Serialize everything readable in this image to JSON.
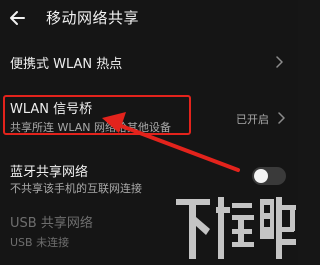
{
  "header": {
    "title": "移动网络共享",
    "back_icon": "back-arrow-icon"
  },
  "rows": [
    {
      "title": "便携式 WLAN 热点",
      "chevron_icon": "chevron-right-icon"
    },
    {
      "title": "WLAN 信号桥",
      "subtitle": "共享所连 WLAN 网络给其他设备",
      "status": "已开启",
      "chevron_icon": "chevron-right-icon"
    },
    {
      "title": "蓝牙共享网络",
      "subtitle": "不共享该手机的互联网连接",
      "toggle_state": "off"
    },
    {
      "title": "USB 共享网络",
      "subtitle": "USB 未连接"
    }
  ],
  "annotation": {
    "highlight_color": "#e3231c",
    "arrow_color": "#e3231c"
  },
  "watermark": {
    "name": "xiazai-logo-watermark",
    "text": "下载吧"
  }
}
